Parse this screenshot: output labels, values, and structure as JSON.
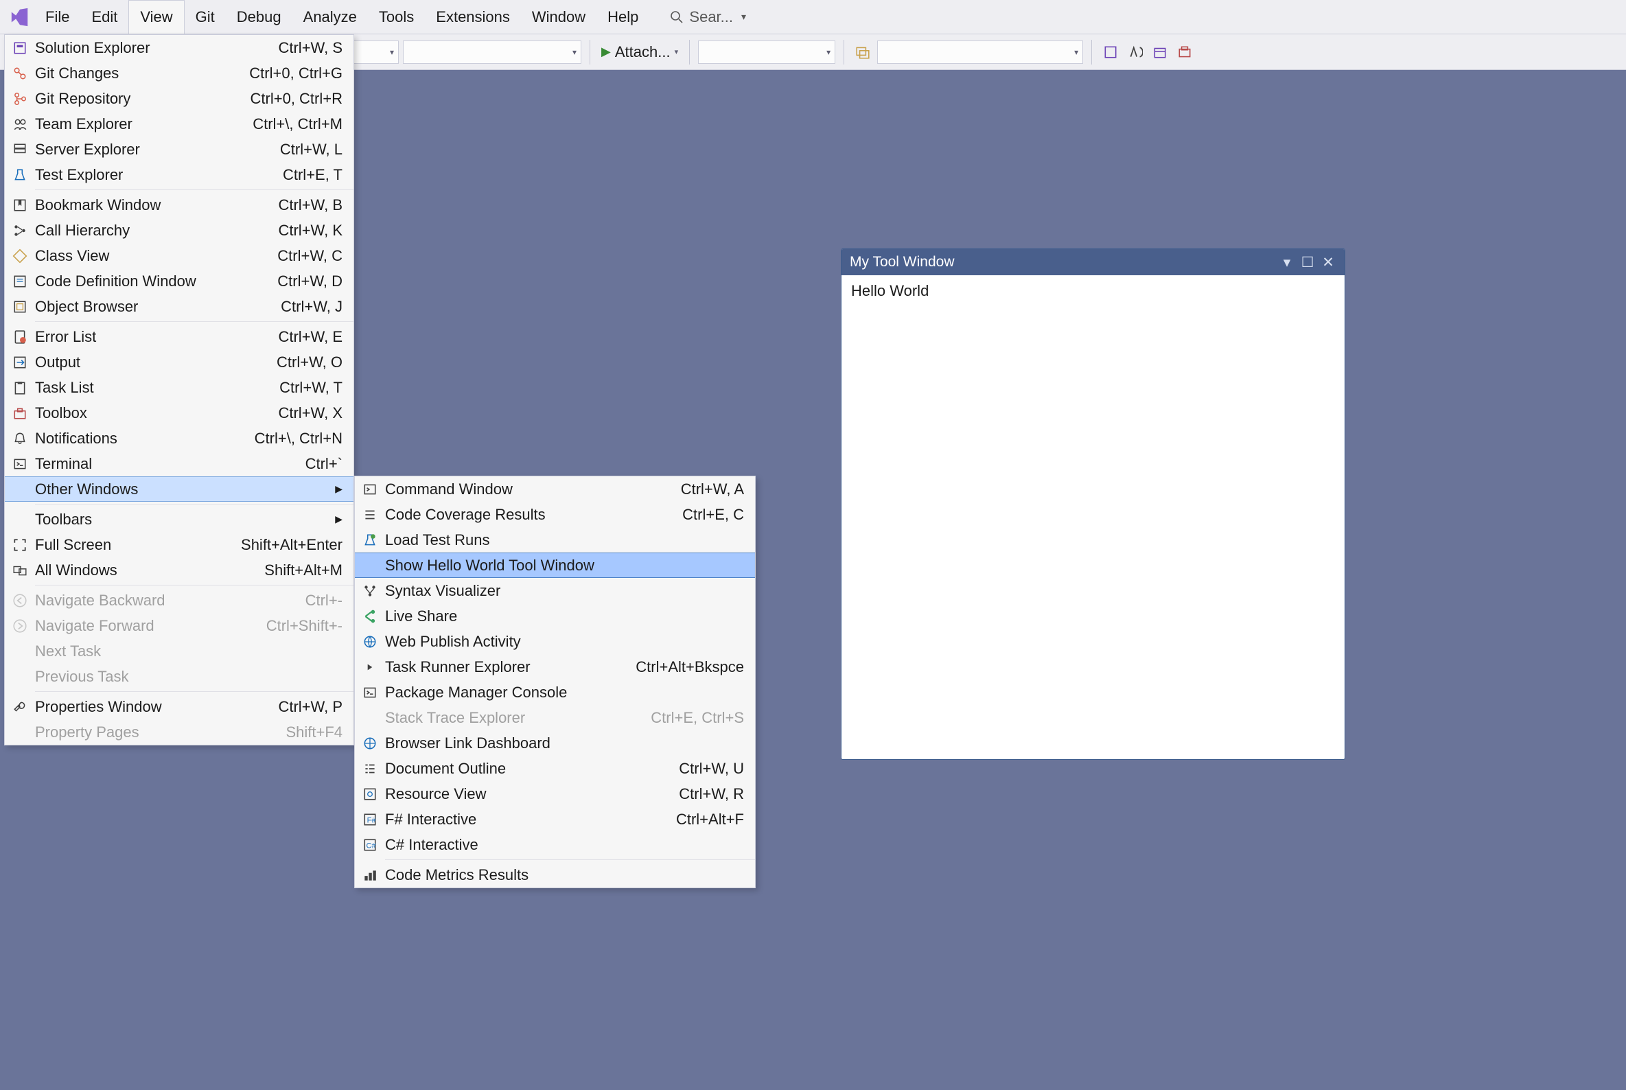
{
  "menubar": {
    "items": [
      {
        "label": "File"
      },
      {
        "label": "Edit"
      },
      {
        "label": "View",
        "active": true
      },
      {
        "label": "Git"
      },
      {
        "label": "Debug"
      },
      {
        "label": "Analyze"
      },
      {
        "label": "Tools"
      },
      {
        "label": "Extensions"
      },
      {
        "label": "Window"
      },
      {
        "label": "Help"
      }
    ],
    "search_placeholder": "Sear..."
  },
  "toolbar": {
    "attach_label": "Attach...",
    "combos": {
      "c1_w": 140,
      "c2_w": 260,
      "c3_w": 200,
      "c4_w": 300
    }
  },
  "view_menu": [
    {
      "icon": "solution-explorer-icon",
      "label": "Solution Explorer",
      "shortcut": "Ctrl+W, S"
    },
    {
      "icon": "git-changes-icon",
      "label": "Git Changes",
      "shortcut": "Ctrl+0, Ctrl+G"
    },
    {
      "icon": "git-repository-icon",
      "label": "Git Repository",
      "shortcut": "Ctrl+0, Ctrl+R"
    },
    {
      "icon": "team-explorer-icon",
      "label": "Team Explorer",
      "shortcut": "Ctrl+\\, Ctrl+M"
    },
    {
      "icon": "server-explorer-icon",
      "label": "Server Explorer",
      "shortcut": "Ctrl+W, L"
    },
    {
      "icon": "test-explorer-icon",
      "label": "Test Explorer",
      "shortcut": "Ctrl+E, T"
    },
    {
      "sep": true
    },
    {
      "icon": "bookmark-window-icon",
      "label": "Bookmark Window",
      "shortcut": "Ctrl+W, B"
    },
    {
      "icon": "call-hierarchy-icon",
      "label": "Call Hierarchy",
      "shortcut": "Ctrl+W, K"
    },
    {
      "icon": "class-view-icon",
      "label": "Class View",
      "shortcut": "Ctrl+W, C"
    },
    {
      "icon": "code-definition-icon",
      "label": "Code Definition Window",
      "shortcut": "Ctrl+W, D"
    },
    {
      "icon": "object-browser-icon",
      "label": "Object Browser",
      "shortcut": "Ctrl+W, J"
    },
    {
      "sep": true
    },
    {
      "icon": "error-list-icon",
      "label": "Error List",
      "shortcut": "Ctrl+W, E"
    },
    {
      "icon": "output-icon",
      "label": "Output",
      "shortcut": "Ctrl+W, O"
    },
    {
      "icon": "task-list-icon",
      "label": "Task List",
      "shortcut": "Ctrl+W, T"
    },
    {
      "icon": "toolbox-icon",
      "label": "Toolbox",
      "shortcut": "Ctrl+W, X"
    },
    {
      "icon": "notifications-icon",
      "label": "Notifications",
      "shortcut": "Ctrl+\\, Ctrl+N"
    },
    {
      "icon": "terminal-icon",
      "label": "Terminal",
      "shortcut": "Ctrl+`"
    },
    {
      "icon": "",
      "label": "Other Windows",
      "shortcut": "",
      "submenu": true,
      "hl": true
    },
    {
      "sep": true
    },
    {
      "icon": "",
      "label": "Toolbars",
      "shortcut": "",
      "submenu": true
    },
    {
      "icon": "full-screen-icon",
      "label": "Full Screen",
      "shortcut": "Shift+Alt+Enter"
    },
    {
      "icon": "all-windows-icon",
      "label": "All Windows",
      "shortcut": "Shift+Alt+M"
    },
    {
      "sep": true
    },
    {
      "icon": "navigate-backward-icon",
      "label": "Navigate Backward",
      "shortcut": "Ctrl+-",
      "disabled": true
    },
    {
      "icon": "navigate-forward-icon",
      "label": "Navigate Forward",
      "shortcut": "Ctrl+Shift+-",
      "disabled": true
    },
    {
      "icon": "",
      "label": "Next Task",
      "shortcut": "",
      "disabled": true
    },
    {
      "icon": "",
      "label": "Previous Task",
      "shortcut": "",
      "disabled": true
    },
    {
      "sep": true
    },
    {
      "icon": "properties-window-icon",
      "label": "Properties Window",
      "shortcut": "Ctrl+W, P"
    },
    {
      "icon": "",
      "label": "Property Pages",
      "shortcut": "Shift+F4",
      "disabled": true
    }
  ],
  "other_windows_menu": [
    {
      "icon": "command-window-icon",
      "label": "Command Window",
      "shortcut": "Ctrl+W, A"
    },
    {
      "icon": "code-coverage-icon",
      "label": "Code Coverage Results",
      "shortcut": "Ctrl+E, C"
    },
    {
      "icon": "load-test-icon",
      "label": "Load Test Runs",
      "shortcut": ""
    },
    {
      "icon": "",
      "label": "Show Hello World Tool Window",
      "shortcut": "",
      "selected": true
    },
    {
      "icon": "syntax-visualizer-icon",
      "label": "Syntax Visualizer",
      "shortcut": ""
    },
    {
      "icon": "live-share-icon",
      "label": "Live Share",
      "shortcut": ""
    },
    {
      "icon": "web-publish-icon",
      "label": "Web Publish Activity",
      "shortcut": ""
    },
    {
      "icon": "task-runner-icon",
      "label": "Task Runner Explorer",
      "shortcut": "Ctrl+Alt+Bkspce"
    },
    {
      "icon": "package-manager-icon",
      "label": "Package Manager Console",
      "shortcut": ""
    },
    {
      "icon": "",
      "label": "Stack Trace Explorer",
      "shortcut": "Ctrl+E, Ctrl+S",
      "disabled": true
    },
    {
      "icon": "browser-link-icon",
      "label": "Browser Link Dashboard",
      "shortcut": ""
    },
    {
      "icon": "document-outline-icon",
      "label": "Document Outline",
      "shortcut": "Ctrl+W, U"
    },
    {
      "icon": "resource-view-icon",
      "label": "Resource View",
      "shortcut": "Ctrl+W, R"
    },
    {
      "icon": "fsharp-interactive-icon",
      "label": "F# Interactive",
      "shortcut": "Ctrl+Alt+F"
    },
    {
      "icon": "csharp-interactive-icon",
      "label": "C# Interactive",
      "shortcut": ""
    },
    {
      "sep": true
    },
    {
      "icon": "code-metrics-icon",
      "label": "Code Metrics Results",
      "shortcut": ""
    }
  ],
  "tool_window": {
    "title": "My Tool Window",
    "body": "Hello World"
  }
}
